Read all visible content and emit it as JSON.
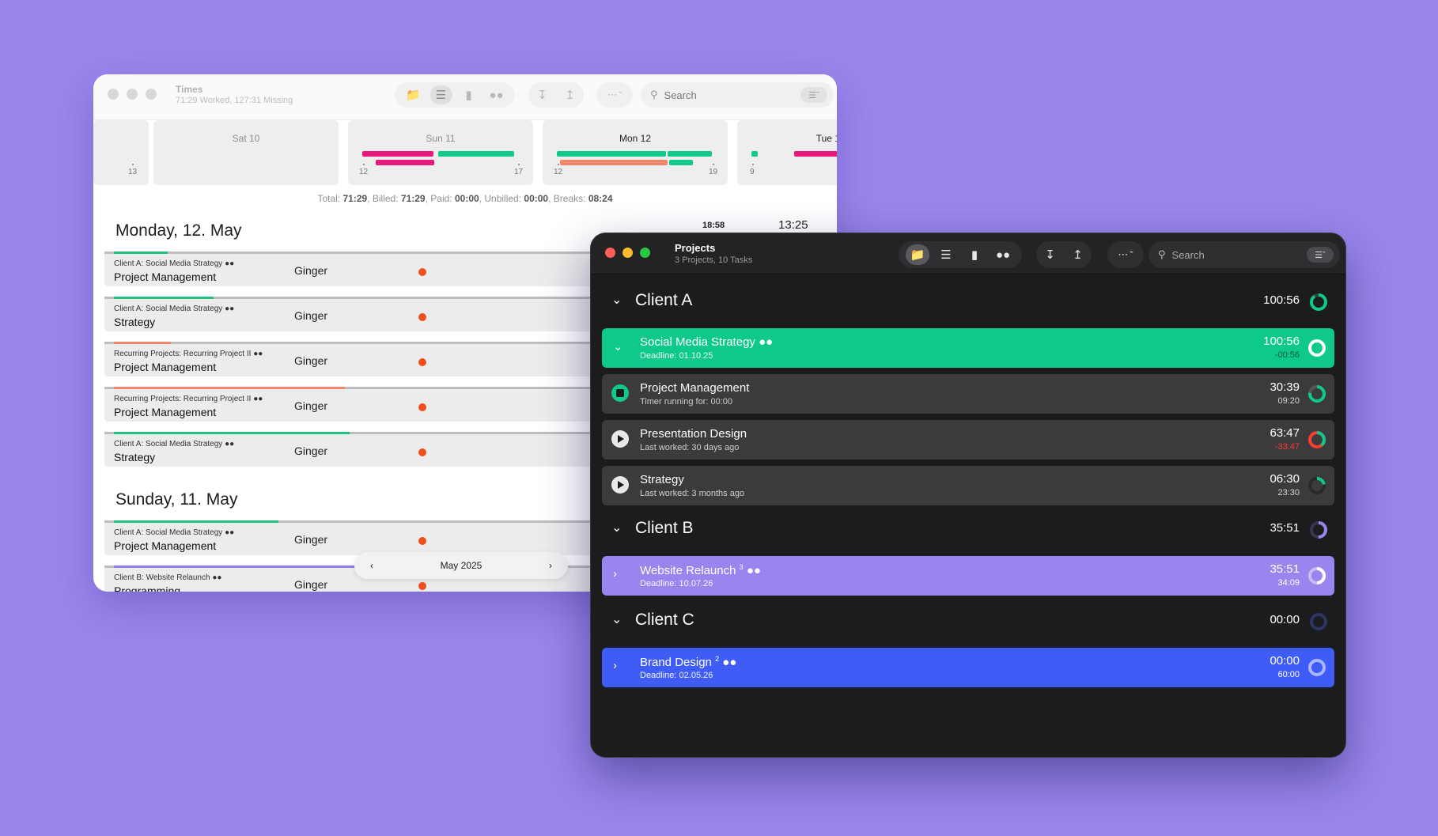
{
  "times_window": {
    "title": "Times",
    "subtitle": "71:29 Worked, 127:31 Missing",
    "search_placeholder": "Search",
    "days": [
      {
        "name": "",
        "ticks": [
          "13"
        ]
      },
      {
        "name": "Sat 10",
        "ticks": []
      },
      {
        "name": "Sun 11",
        "ticks": [
          "12",
          "17"
        ]
      },
      {
        "name": "Mon 12",
        "ticks": [
          "12",
          "19"
        ]
      },
      {
        "name": "Tue 1",
        "ticks": [
          "9"
        ]
      }
    ],
    "totals": {
      "total_label": "Total:",
      "total": "71:29",
      "billed_label": "Billed:",
      "billed": "71:29",
      "paid_label": "Paid:",
      "paid": "00:00",
      "unbilled_label": "Unbilled:",
      "unbilled": "00:00",
      "breaks_label": "Breaks:",
      "breaks": "08:24"
    },
    "section1": {
      "title": "Monday, 12. May",
      "mini_time": "18:58",
      "big_time": "13:25"
    },
    "section2": {
      "title": "Sunday, 11. May"
    },
    "entries_monday": [
      {
        "context": "Client A: Social Media Strategy",
        "task": "Project Management",
        "person": "Ginger",
        "color": "#1fc17f"
      },
      {
        "context": "Client A: Social Media Strategy",
        "task": "Strategy",
        "person": "Ginger",
        "color": "#1fc17f"
      },
      {
        "context": "Recurring Projects: Recurring Project II",
        "task": "Project Management",
        "person": "Ginger",
        "color": "#f0876a"
      },
      {
        "context": "Recurring Projects: Recurring Project II",
        "task": "Project Management",
        "person": "Ginger",
        "color": "#f0876a"
      },
      {
        "context": "Client A: Social Media Strategy",
        "task": "Strategy",
        "person": "Ginger",
        "color": "#1fc17f"
      }
    ],
    "entries_sunday": [
      {
        "context": "Client A: Social Media Strategy",
        "task": "Project Management",
        "person": "Ginger",
        "color": "#1fc17f"
      },
      {
        "context": "Client B: Website Relaunch",
        "task": "Programming",
        "person": "Ginger",
        "color": "#8e7cf0"
      }
    ],
    "month_nav": {
      "label": "May 2025"
    }
  },
  "projects_window": {
    "title": "Projects",
    "subtitle": "3 Projects, 10 Tasks",
    "search_placeholder": "Search",
    "clients": [
      {
        "name": "Client A",
        "time": "100:56"
      },
      {
        "name": "Client B",
        "time": "35:51"
      },
      {
        "name": "Client C",
        "time": "00:00"
      }
    ],
    "projects": [
      {
        "name": "Social Media Strategy",
        "deadline": "Deadline: 01.10.25",
        "time": "100:56",
        "diff": "-00:56",
        "color": "#0ec98a"
      },
      {
        "name": "Website Relaunch",
        "badge": "3",
        "deadline": "Deadline: 10.07.26",
        "time": "35:51",
        "diff": "34:09",
        "color": "#9a84ee"
      },
      {
        "name": "Brand Design",
        "badge": "2",
        "deadline": "Deadline: 02.05.26",
        "time": "00:00",
        "diff": "60:00",
        "color": "#3f5cf6"
      }
    ],
    "tasks": [
      {
        "name": "Project Management",
        "sub": "Timer running for: 00:00",
        "time": "30:39",
        "diff": "09:20",
        "progress": 0.77
      },
      {
        "name": "Presentation Design",
        "sub": "Last worked: 30 days ago",
        "time": "63:47",
        "diff": "-33:47",
        "progress": 1.0
      },
      {
        "name": "Strategy",
        "sub": "Last worked: 3 months ago",
        "time": "06:30",
        "diff": "23:30",
        "progress": 0.22
      }
    ],
    "client_progress": [
      0.9,
      0.5,
      0.0
    ],
    "colors": {
      "green": "#0ec98a",
      "purple": "#9a84ee",
      "blue": "#3f5cf6",
      "negative": "#ff3b30"
    }
  }
}
